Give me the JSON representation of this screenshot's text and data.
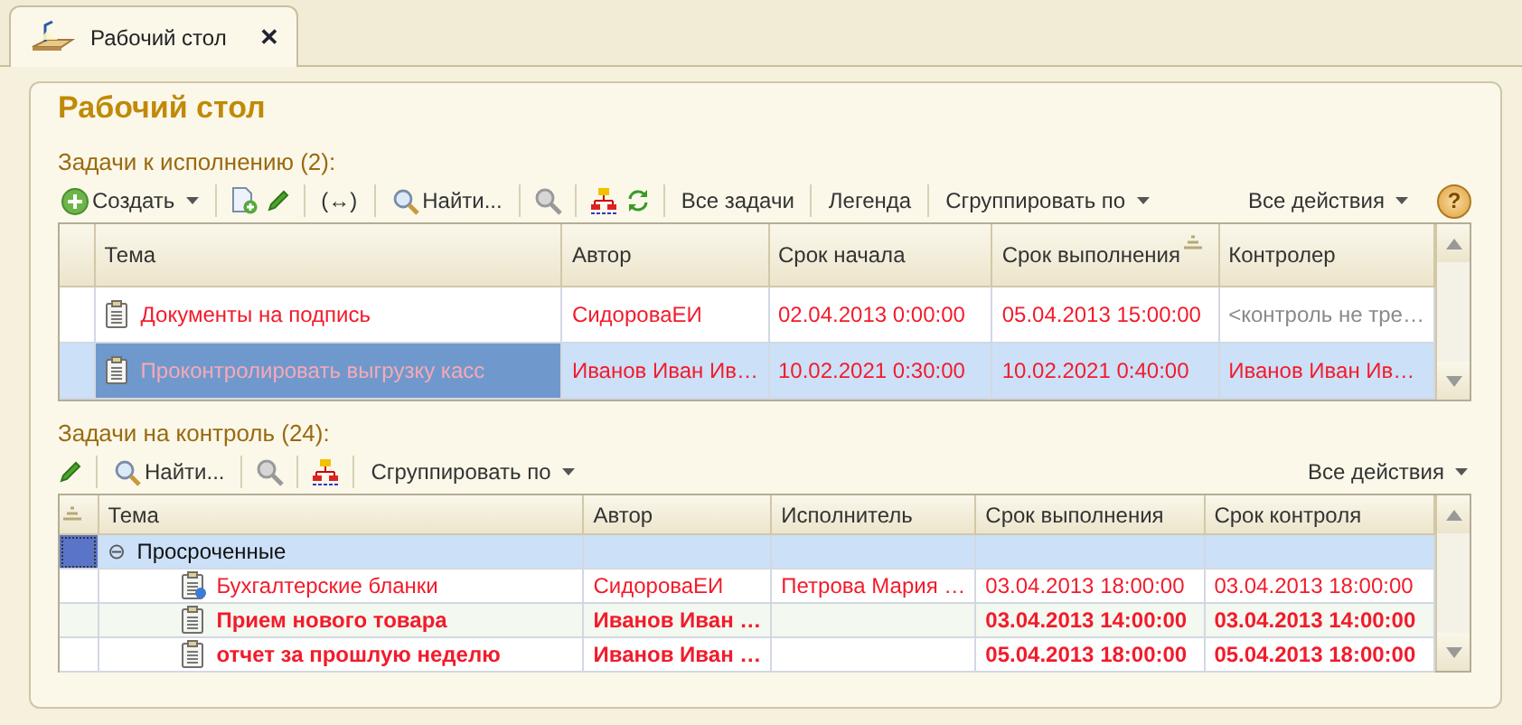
{
  "tab": {
    "label": "Рабочий стол",
    "close": "✕",
    "selected": true
  },
  "title": "Рабочий стол",
  "execution": {
    "label": "Задачи к исполнению (2):",
    "toolbar": [
      {
        "kind": "create",
        "label": "Создать",
        "dropdown": true
      },
      {
        "kind": "sep"
      },
      {
        "kind": "copy"
      },
      {
        "kind": "edit"
      },
      {
        "kind": "sep"
      },
      {
        "kind": "width",
        "label": "(↔)"
      },
      {
        "kind": "sep"
      },
      {
        "kind": "find",
        "label": "Найти..."
      },
      {
        "kind": "sep"
      },
      {
        "kind": "cancel-find"
      },
      {
        "kind": "sep"
      },
      {
        "kind": "tree"
      },
      {
        "kind": "refresh"
      },
      {
        "kind": "sep"
      },
      {
        "kind": "text",
        "label": "Все задачи"
      },
      {
        "kind": "sep"
      },
      {
        "kind": "text",
        "label": "Легенда"
      },
      {
        "kind": "sep"
      },
      {
        "kind": "text",
        "label": "Сгруппировать по",
        "dropdown": true
      }
    ],
    "actions": {
      "label": "Все действия",
      "dropdown": true
    },
    "help": "?",
    "columns": [
      {
        "label": "Тема",
        "sorted": false
      },
      {
        "label": "Автор",
        "sorted": false
      },
      {
        "label": "Срок начала",
        "sorted": false
      },
      {
        "label": "Срок выполнения",
        "sorted": true
      },
      {
        "label": "Контролер",
        "sorted": false
      }
    ],
    "rows": [
      {
        "kind": "task",
        "selected": false,
        "cells": [
          {
            "text": "Документы на подпись"
          },
          {
            "text": "СидороваЕИ"
          },
          {
            "text": "02.04.2013 0:00:00"
          },
          {
            "text": "05.04.2013 15:00:00"
          },
          {
            "text": "<контроль не тре…",
            "muted": true
          }
        ]
      },
      {
        "kind": "task",
        "selected": true,
        "cells": [
          {
            "text": "Проконтролировать выгрузку касс"
          },
          {
            "text": "Иванов Иван Ив…"
          },
          {
            "text": "10.02.2021 0:30:00"
          },
          {
            "text": "10.02.2021 0:40:00"
          },
          {
            "text": "Иванов Иван Ив…"
          }
        ]
      }
    ]
  },
  "control": {
    "label": "Задачи на контроль (24):",
    "toolbar": [
      {
        "kind": "edit"
      },
      {
        "kind": "sep"
      },
      {
        "kind": "find",
        "label": "Найти..."
      },
      {
        "kind": "sep"
      },
      {
        "kind": "cancel-find"
      },
      {
        "kind": "sep"
      },
      {
        "kind": "tree"
      },
      {
        "kind": "sep"
      },
      {
        "kind": "text",
        "label": "Сгруппировать по",
        "dropdown": true
      }
    ],
    "actions": {
      "label": "Все действия",
      "dropdown": true
    },
    "marker_sorted": true,
    "columns": [
      {
        "label": "Тема",
        "sorted": false
      },
      {
        "label": "Автор",
        "sorted": false
      },
      {
        "label": "Исполнитель",
        "sorted": false
      },
      {
        "label": "Срок выполнения",
        "sorted": false
      },
      {
        "label": "Срок контроля",
        "sorted": false
      }
    ],
    "rows": [
      {
        "kind": "group",
        "selected": true,
        "expanded": true,
        "toggle": "⊖",
        "label": "Просроченные",
        "children": [
          {
            "kind": "task-question",
            "selected": false,
            "cells": [
              {
                "text": "Бухгалтерские бланки"
              },
              {
                "text": "СидороваЕИ"
              },
              {
                "text": "Петрова Мария …"
              },
              {
                "text": "03.04.2013 18:00:00"
              },
              {
                "text": "03.04.2013 18:00:00"
              }
            ]
          },
          {
            "kind": "task",
            "selected": false,
            "bold": true,
            "cells": [
              {
                "text": "Прием нового товара"
              },
              {
                "text": "Иванов Иван …"
              },
              {},
              {
                "text": "03.04.2013 14:00:00"
              },
              {
                "text": "03.04.2013 14:00:00"
              }
            ]
          },
          {
            "kind": "task",
            "selected": false,
            "bold": true,
            "cells": [
              {
                "text": "отчет за прошлую неделю"
              },
              {
                "text": "Иванов Иван …"
              },
              {},
              {
                "text": "05.04.2013 18:00:00"
              },
              {
                "text": "05.04.2013 18:00:00"
              }
            ]
          }
        ]
      }
    ]
  }
}
